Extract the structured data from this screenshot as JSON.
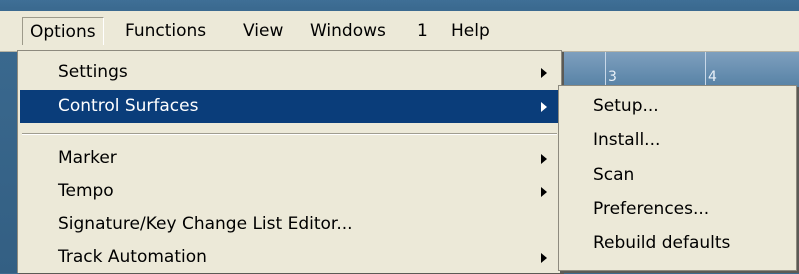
{
  "menubar": {
    "items": [
      {
        "label": "Options"
      },
      {
        "label": "Functions"
      },
      {
        "label": "View"
      },
      {
        "label": "Windows"
      },
      {
        "label": "1"
      },
      {
        "label": "Help"
      }
    ]
  },
  "ruler": {
    "marks": [
      "3",
      "4"
    ]
  },
  "options_menu": {
    "items": [
      {
        "label": "Settings",
        "submenu": true
      },
      {
        "label": "Control Surfaces",
        "submenu": true,
        "highlighted": true
      },
      {
        "label": "Marker",
        "submenu": true
      },
      {
        "label": "Tempo",
        "submenu": true
      },
      {
        "label": "Signature/Key Change List Editor...",
        "submenu": false
      },
      {
        "label": "Track Automation",
        "submenu": true
      }
    ]
  },
  "control_surfaces_submenu": {
    "items": [
      {
        "label": "Setup..."
      },
      {
        "label": "Install..."
      },
      {
        "label": "Scan"
      },
      {
        "label": "Preferences..."
      },
      {
        "label": "Rebuild defaults"
      }
    ]
  },
  "colors": {
    "highlight": "#0a3d7a",
    "menu_bg": "#ece9d8",
    "app_bg": "#3d6a8e"
  }
}
